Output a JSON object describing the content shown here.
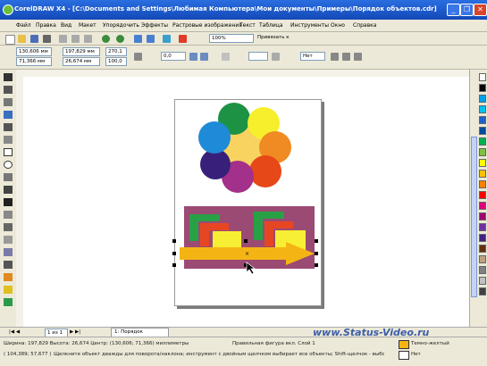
{
  "window": {
    "title": "CorelDRAW X4 - [C:\\Documents and Settings\\Любимая Компьютера\\Мои документы\\Примеры\\Порядок объектов.cdr]",
    "min_symbol": "_",
    "restore_symbol": "❐",
    "close_symbol": "✕"
  },
  "menu": [
    "Файл",
    "Правка",
    "Вид",
    "Макет",
    "Упорядочить",
    "Эффекты",
    "Растровые изображения",
    "Текст",
    "Таблица",
    "Инструменты",
    "Окно",
    "Справка"
  ],
  "toolbar": {
    "zoom_value": "100%",
    "snap_label": "Привязать к"
  },
  "propertybar": {
    "x_value": "130,606 мм",
    "y_value": "71,366 мм",
    "width_value": "197,829 мм",
    "height_value": "26,674 мм",
    "scale_x": "270,1",
    "scale_y": "100,0",
    "angle": "0,0",
    "outline": "Нет"
  },
  "pages": {
    "counter": "1 из 1",
    "tab_label": "1: Порядок"
  },
  "status": {
    "line1": "Ширина: 197,829  Высота: 26,674  Центр: (130,606; 71,366)  миллиметры",
    "line1_right": "Правильная фигура вкл. Слой 1",
    "line2": "( 104,389; 57,677 )",
    "line2_hint": "Щелкните объект дважды для поворота/наклона; инструмент с двойным щелчком выбирает все объекты; Shift-щелчок - выбор...",
    "fill_label": "Темно-желтый",
    "outline_label": "Нет"
  },
  "watermark": "www.Status-Video.ru",
  "colors": {
    "title_bar": "#1f5bd0",
    "flower_center": "#f8d35f",
    "petals": [
      "#1e9244",
      "#f7ef2c",
      "#f08a22",
      "#e64818",
      "#a3308a",
      "#38207a",
      "#1e8ad8"
    ],
    "rect_bg": "#9b4a73",
    "green_shape": "#28a046",
    "red_shape": "#e74623",
    "yellow_shape": "#f7ef33",
    "arrow": "#f4b514"
  },
  "palette": [
    "#ffffff",
    "#000000",
    "#00a0e9",
    "#00c0f0",
    "#2060c8",
    "#004aa0",
    "#00b050",
    "#80c040",
    "#ffff00",
    "#ffc000",
    "#ff8000",
    "#ff0000",
    "#e0007a",
    "#a0006e",
    "#7030a0",
    "#402080",
    "#603010",
    "#c0a080",
    "#808080",
    "#c0c0c0",
    "#404040"
  ]
}
